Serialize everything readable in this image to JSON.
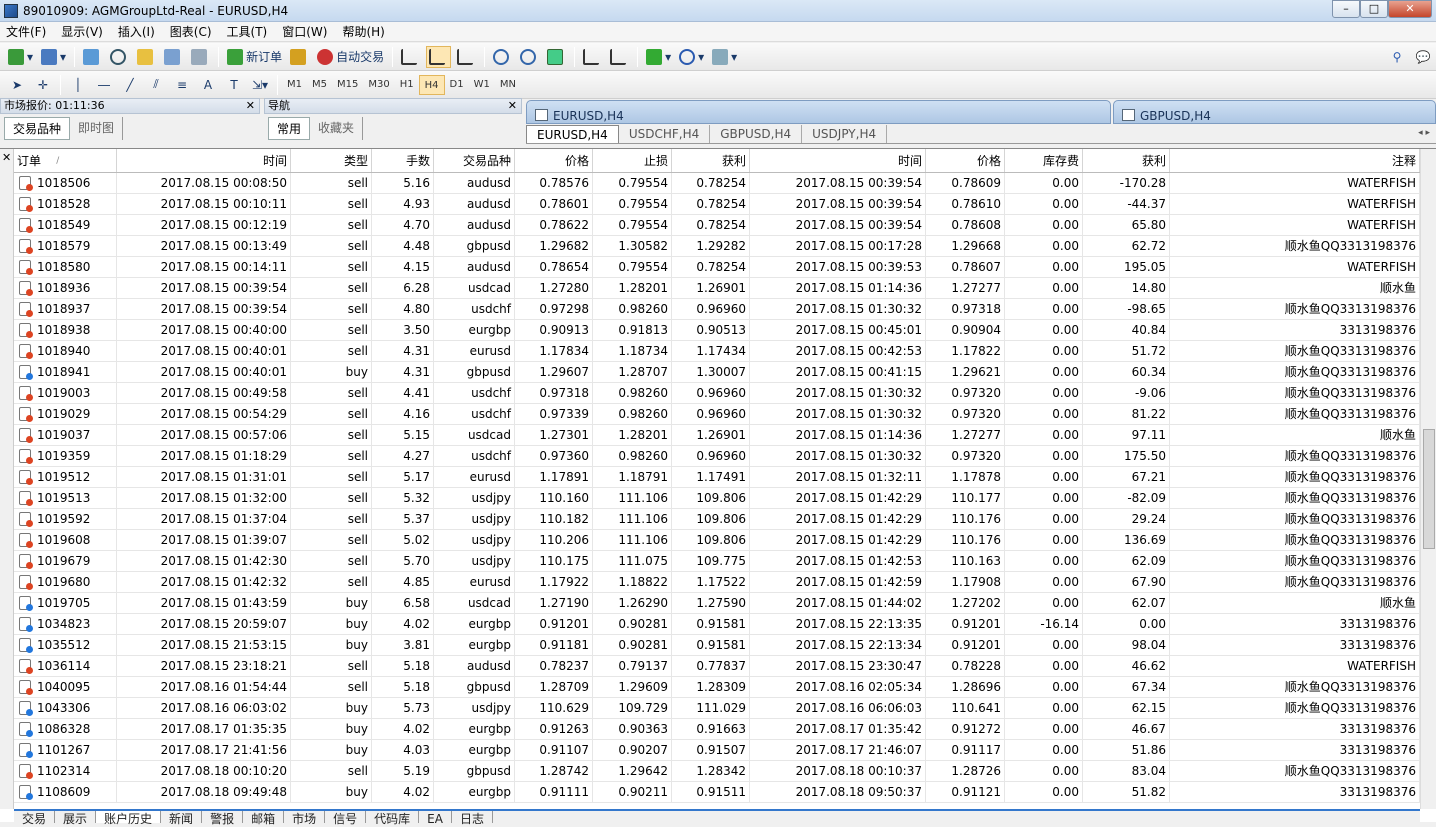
{
  "window": {
    "title": "89010909: AGMGroupLtd-Real - EURUSD,H4",
    "btn_min": "–",
    "btn_max": "□",
    "btn_close": "✕"
  },
  "menu": [
    "文件(F)",
    "显示(V)",
    "插入(I)",
    "图表(C)",
    "工具(T)",
    "窗口(W)",
    "帮助(H)"
  ],
  "toolbar": {
    "new_order": "新订单",
    "auto_trade": "自动交易"
  },
  "timeframes": [
    "M1",
    "M5",
    "M15",
    "M30",
    "H1",
    "H4",
    "D1",
    "W1",
    "MN"
  ],
  "selected_timeframe": "H4",
  "market_watch": {
    "title": "市场报价: 01:11:36",
    "close": "✕",
    "tabs": [
      "交易品种",
      "即时图"
    ]
  },
  "navigator": {
    "title": "导航",
    "close": "✕",
    "tabs": [
      "常用",
      "收藏夹"
    ]
  },
  "chart_windows": [
    "EURUSD,H4",
    "GBPUSD,H4"
  ],
  "chart_tabs": [
    "EURUSD,H4",
    "USDCHF,H4",
    "GBPUSD,H4",
    "USDJPY,H4"
  ],
  "terminal": {
    "close": "✕",
    "headers": [
      "订单",
      "时间",
      "类型",
      "手数",
      "交易品种",
      "价格",
      "止损",
      "获利",
      "时间",
      "价格",
      "库存费",
      "获利",
      "注释"
    ],
    "sort_mark": "/",
    "rows": [
      [
        "1018506",
        "2017.08.15 00:08:50",
        "sell",
        "5.16",
        "audusd",
        "0.78576",
        "0.79554",
        "0.78254",
        "2017.08.15 00:39:54",
        "0.78609",
        "0.00",
        "-170.28",
        "WATERFISH"
      ],
      [
        "1018528",
        "2017.08.15 00:10:11",
        "sell",
        "4.93",
        "audusd",
        "0.78601",
        "0.79554",
        "0.78254",
        "2017.08.15 00:39:54",
        "0.78610",
        "0.00",
        "-44.37",
        "WATERFISH"
      ],
      [
        "1018549",
        "2017.08.15 00:12:19",
        "sell",
        "4.70",
        "audusd",
        "0.78622",
        "0.79554",
        "0.78254",
        "2017.08.15 00:39:54",
        "0.78608",
        "0.00",
        "65.80",
        "WATERFISH"
      ],
      [
        "1018579",
        "2017.08.15 00:13:49",
        "sell",
        "4.48",
        "gbpusd",
        "1.29682",
        "1.30582",
        "1.29282",
        "2017.08.15 00:17:28",
        "1.29668",
        "0.00",
        "62.72",
        "顺水鱼QQ3313198376"
      ],
      [
        "1018580",
        "2017.08.15 00:14:11",
        "sell",
        "4.15",
        "audusd",
        "0.78654",
        "0.79554",
        "0.78254",
        "2017.08.15 00:39:53",
        "0.78607",
        "0.00",
        "195.05",
        "WATERFISH"
      ],
      [
        "1018936",
        "2017.08.15 00:39:54",
        "sell",
        "6.28",
        "usdcad",
        "1.27280",
        "1.28201",
        "1.26901",
        "2017.08.15 01:14:36",
        "1.27277",
        "0.00",
        "14.80",
        "顺水鱼"
      ],
      [
        "1018937",
        "2017.08.15 00:39:54",
        "sell",
        "4.80",
        "usdchf",
        "0.97298",
        "0.98260",
        "0.96960",
        "2017.08.15 01:30:32",
        "0.97318",
        "0.00",
        "-98.65",
        "顺水鱼QQ3313198376"
      ],
      [
        "1018938",
        "2017.08.15 00:40:00",
        "sell",
        "3.50",
        "eurgbp",
        "0.90913",
        "0.91813",
        "0.90513",
        "2017.08.15 00:45:01",
        "0.90904",
        "0.00",
        "40.84",
        "3313198376"
      ],
      [
        "1018940",
        "2017.08.15 00:40:01",
        "sell",
        "4.31",
        "eurusd",
        "1.17834",
        "1.18734",
        "1.17434",
        "2017.08.15 00:42:53",
        "1.17822",
        "0.00",
        "51.72",
        "顺水鱼QQ3313198376"
      ],
      [
        "1018941",
        "2017.08.15 00:40:01",
        "buy",
        "4.31",
        "gbpusd",
        "1.29607",
        "1.28707",
        "1.30007",
        "2017.08.15 00:41:15",
        "1.29621",
        "0.00",
        "60.34",
        "顺水鱼QQ3313198376"
      ],
      [
        "1019003",
        "2017.08.15 00:49:58",
        "sell",
        "4.41",
        "usdchf",
        "0.97318",
        "0.98260",
        "0.96960",
        "2017.08.15 01:30:32",
        "0.97320",
        "0.00",
        "-9.06",
        "顺水鱼QQ3313198376"
      ],
      [
        "1019029",
        "2017.08.15 00:54:29",
        "sell",
        "4.16",
        "usdchf",
        "0.97339",
        "0.98260",
        "0.96960",
        "2017.08.15 01:30:32",
        "0.97320",
        "0.00",
        "81.22",
        "顺水鱼QQ3313198376"
      ],
      [
        "1019037",
        "2017.08.15 00:57:06",
        "sell",
        "5.15",
        "usdcad",
        "1.27301",
        "1.28201",
        "1.26901",
        "2017.08.15 01:14:36",
        "1.27277",
        "0.00",
        "97.11",
        "顺水鱼"
      ],
      [
        "1019359",
        "2017.08.15 01:18:29",
        "sell",
        "4.27",
        "usdchf",
        "0.97360",
        "0.98260",
        "0.96960",
        "2017.08.15 01:30:32",
        "0.97320",
        "0.00",
        "175.50",
        "顺水鱼QQ3313198376"
      ],
      [
        "1019512",
        "2017.08.15 01:31:01",
        "sell",
        "5.17",
        "eurusd",
        "1.17891",
        "1.18791",
        "1.17491",
        "2017.08.15 01:32:11",
        "1.17878",
        "0.00",
        "67.21",
        "顺水鱼QQ3313198376"
      ],
      [
        "1019513",
        "2017.08.15 01:32:00",
        "sell",
        "5.32",
        "usdjpy",
        "110.160",
        "111.106",
        "109.806",
        "2017.08.15 01:42:29",
        "110.177",
        "0.00",
        "-82.09",
        "顺水鱼QQ3313198376"
      ],
      [
        "1019592",
        "2017.08.15 01:37:04",
        "sell",
        "5.37",
        "usdjpy",
        "110.182",
        "111.106",
        "109.806",
        "2017.08.15 01:42:29",
        "110.176",
        "0.00",
        "29.24",
        "顺水鱼QQ3313198376"
      ],
      [
        "1019608",
        "2017.08.15 01:39:07",
        "sell",
        "5.02",
        "usdjpy",
        "110.206",
        "111.106",
        "109.806",
        "2017.08.15 01:42:29",
        "110.176",
        "0.00",
        "136.69",
        "顺水鱼QQ3313198376"
      ],
      [
        "1019679",
        "2017.08.15 01:42:30",
        "sell",
        "5.70",
        "usdjpy",
        "110.175",
        "111.075",
        "109.775",
        "2017.08.15 01:42:53",
        "110.163",
        "0.00",
        "62.09",
        "顺水鱼QQ3313198376"
      ],
      [
        "1019680",
        "2017.08.15 01:42:32",
        "sell",
        "4.85",
        "eurusd",
        "1.17922",
        "1.18822",
        "1.17522",
        "2017.08.15 01:42:59",
        "1.17908",
        "0.00",
        "67.90",
        "顺水鱼QQ3313198376"
      ],
      [
        "1019705",
        "2017.08.15 01:43:59",
        "buy",
        "6.58",
        "usdcad",
        "1.27190",
        "1.26290",
        "1.27590",
        "2017.08.15 01:44:02",
        "1.27202",
        "0.00",
        "62.07",
        "顺水鱼"
      ],
      [
        "1034823",
        "2017.08.15 20:59:07",
        "buy",
        "4.02",
        "eurgbp",
        "0.91201",
        "0.90281",
        "0.91581",
        "2017.08.15 22:13:35",
        "0.91201",
        "-16.14",
        "0.00",
        "3313198376"
      ],
      [
        "1035512",
        "2017.08.15 21:53:15",
        "buy",
        "3.81",
        "eurgbp",
        "0.91181",
        "0.90281",
        "0.91581",
        "2017.08.15 22:13:34",
        "0.91201",
        "0.00",
        "98.04",
        "3313198376"
      ],
      [
        "1036114",
        "2017.08.15 23:18:21",
        "sell",
        "5.18",
        "audusd",
        "0.78237",
        "0.79137",
        "0.77837",
        "2017.08.15 23:30:47",
        "0.78228",
        "0.00",
        "46.62",
        "WATERFISH"
      ],
      [
        "1040095",
        "2017.08.16 01:54:44",
        "sell",
        "5.18",
        "gbpusd",
        "1.28709",
        "1.29609",
        "1.28309",
        "2017.08.16 02:05:34",
        "1.28696",
        "0.00",
        "67.34",
        "顺水鱼QQ3313198376"
      ],
      [
        "1043306",
        "2017.08.16 06:03:02",
        "buy",
        "5.73",
        "usdjpy",
        "110.629",
        "109.729",
        "111.029",
        "2017.08.16 06:06:03",
        "110.641",
        "0.00",
        "62.15",
        "顺水鱼QQ3313198376"
      ],
      [
        "1086328",
        "2017.08.17 01:35:35",
        "buy",
        "4.02",
        "eurgbp",
        "0.91263",
        "0.90363",
        "0.91663",
        "2017.08.17 01:35:42",
        "0.91272",
        "0.00",
        "46.67",
        "3313198376"
      ],
      [
        "1101267",
        "2017.08.17 21:41:56",
        "buy",
        "4.03",
        "eurgbp",
        "0.91107",
        "0.90207",
        "0.91507",
        "2017.08.17 21:46:07",
        "0.91117",
        "0.00",
        "51.86",
        "3313198376"
      ],
      [
        "1102314",
        "2017.08.18 00:10:20",
        "sell",
        "5.19",
        "gbpusd",
        "1.28742",
        "1.29642",
        "1.28342",
        "2017.08.18 00:10:37",
        "1.28726",
        "0.00",
        "83.04",
        "顺水鱼QQ3313198376"
      ],
      [
        "1108609",
        "2017.08.18 09:49:48",
        "buy",
        "4.02",
        "eurgbp",
        "0.91111",
        "0.90211",
        "0.91511",
        "2017.08.18 09:50:37",
        "0.91121",
        "0.00",
        "51.82",
        "3313198376"
      ]
    ],
    "bottom_tabs": [
      "交易",
      "展示",
      "账户历史",
      "新闻",
      "警报",
      "邮箱",
      "市场",
      "信号",
      "代码库",
      "EA",
      "日志"
    ],
    "selected_bottom_tab": "账户历史"
  }
}
